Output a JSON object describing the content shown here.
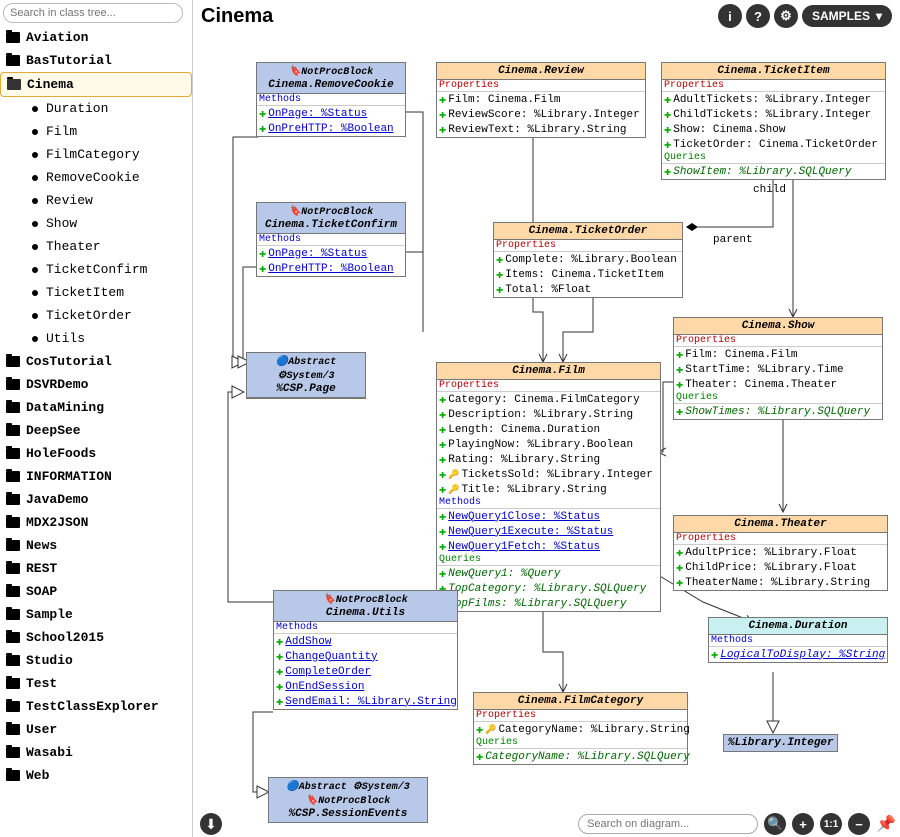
{
  "search": {
    "placeholder": "Search in class tree..."
  },
  "sidebar": {
    "items": [
      {
        "label": "Aviation",
        "type": "folder"
      },
      {
        "label": "BasTutorial",
        "type": "folder"
      },
      {
        "label": "Cinema",
        "type": "folder",
        "selected": true
      },
      {
        "label": "Duration",
        "type": "child"
      },
      {
        "label": "Film",
        "type": "child"
      },
      {
        "label": "FilmCategory",
        "type": "child"
      },
      {
        "label": "RemoveCookie",
        "type": "child"
      },
      {
        "label": "Review",
        "type": "child"
      },
      {
        "label": "Show",
        "type": "child"
      },
      {
        "label": "Theater",
        "type": "child"
      },
      {
        "label": "TicketConfirm",
        "type": "child"
      },
      {
        "label": "TicketItem",
        "type": "child"
      },
      {
        "label": "TicketOrder",
        "type": "child"
      },
      {
        "label": "Utils",
        "type": "child"
      },
      {
        "label": "CosTutorial",
        "type": "folder"
      },
      {
        "label": "DSVRDemo",
        "type": "folder"
      },
      {
        "label": "DataMining",
        "type": "folder"
      },
      {
        "label": "DeepSee",
        "type": "folder"
      },
      {
        "label": "HoleFoods",
        "type": "folder"
      },
      {
        "label": "INFORMATION",
        "type": "folder"
      },
      {
        "label": "JavaDemo",
        "type": "folder"
      },
      {
        "label": "MDX2JSON",
        "type": "folder"
      },
      {
        "label": "News",
        "type": "folder"
      },
      {
        "label": "REST",
        "type": "folder"
      },
      {
        "label": "SOAP",
        "type": "folder"
      },
      {
        "label": "Sample",
        "type": "folder"
      },
      {
        "label": "School2015",
        "type": "folder"
      },
      {
        "label": "Studio",
        "type": "folder"
      },
      {
        "label": "Test",
        "type": "folder"
      },
      {
        "label": "TestClassExplorer",
        "type": "folder"
      },
      {
        "label": "User",
        "type": "folder"
      },
      {
        "label": "Wasabi",
        "type": "folder"
      },
      {
        "label": "Web",
        "type": "folder"
      }
    ]
  },
  "header": {
    "title": "Cinema",
    "samples": "SAMPLES"
  },
  "boxes": {
    "removeCookie": {
      "tag": "NotProcBlock",
      "title": "Cinema.RemoveCookie",
      "methods": [
        "OnPage: %Status",
        "OnPreHTTP: %Boolean"
      ]
    },
    "review": {
      "title": "Cinema.Review",
      "props": [
        "Film: Cinema.Film",
        "ReviewScore: %Library.Integer",
        "ReviewText: %Library.String"
      ]
    },
    "ticketItem": {
      "title": "Cinema.TicketItem",
      "props": [
        "AdultTickets: %Library.Integer",
        "ChildTickets: %Library.Integer",
        "Show: Cinema.Show",
        "TicketOrder: Cinema.TicketOrder"
      ],
      "queries": [
        "ShowItem: %Library.SQLQuery"
      ]
    },
    "ticketConfirm": {
      "tag": "NotProcBlock",
      "title": "Cinema.TicketConfirm",
      "methods": [
        "OnPage: %Status",
        "OnPreHTTP: %Boolean"
      ]
    },
    "ticketOrder": {
      "title": "Cinema.TicketOrder",
      "props": [
        "Complete: %Library.Boolean",
        "Items: Cinema.TicketItem",
        "Total: %Float"
      ]
    },
    "show": {
      "title": "Cinema.Show",
      "props": [
        "Film: Cinema.Film",
        "StartTime: %Library.Time",
        "Theater: Cinema.Theater"
      ],
      "queries": [
        "ShowTimes: %Library.SQLQuery"
      ]
    },
    "cspPage": {
      "tag1": "Abstract",
      "tag2": "System/3",
      "title": "%CSP.Page"
    },
    "film": {
      "title": "Cinema.Film",
      "props": [
        "Category: Cinema.FilmCategory",
        "Description: %Library.String",
        "Length: Cinema.Duration",
        "PlayingNow: %Library.Boolean",
        "Rating: %Library.String",
        "TicketsSold: %Library.Integer",
        "Title: %Library.String"
      ],
      "methods": [
        "NewQuery1Close: %Status",
        "NewQuery1Execute: %Status",
        "NewQuery1Fetch: %Status"
      ],
      "queries": [
        "NewQuery1: %Query",
        "TopCategory: %Library.SQLQuery",
        "TopFilms: %Library.SQLQuery"
      ]
    },
    "theater": {
      "title": "Cinema.Theater",
      "props": [
        "AdultPrice: %Library.Float",
        "ChildPrice: %Library.Float",
        "TheaterName: %Library.String"
      ]
    },
    "utils": {
      "tag": "NotProcBlock",
      "title": "Cinema.Utils",
      "methods": [
        "AddShow",
        "ChangeQuantity",
        "CompleteOrder",
        "OnEndSession",
        "SendEmail: %Library.String"
      ]
    },
    "duration": {
      "title": "Cinema.Duration",
      "methods": [
        "LogicalToDisplay: %String"
      ]
    },
    "filmCategory": {
      "title": "Cinema.FilmCategory",
      "props": [
        "CategoryName: %Library.String"
      ],
      "queries": [
        "CategoryName: %Library.SQLQuery"
      ]
    },
    "libInteger": {
      "title": "%Library.Integer"
    },
    "sessionEvents": {
      "tag1": "Abstract",
      "tag2": "System/3",
      "tag3": "NotProcBlock",
      "title": "%CSP.SessionEvents"
    }
  },
  "edges": {
    "child": "child",
    "parent": "parent"
  },
  "bottom": {
    "search_placeholder": "Search on diagram...",
    "zoom_label": "1:1"
  }
}
